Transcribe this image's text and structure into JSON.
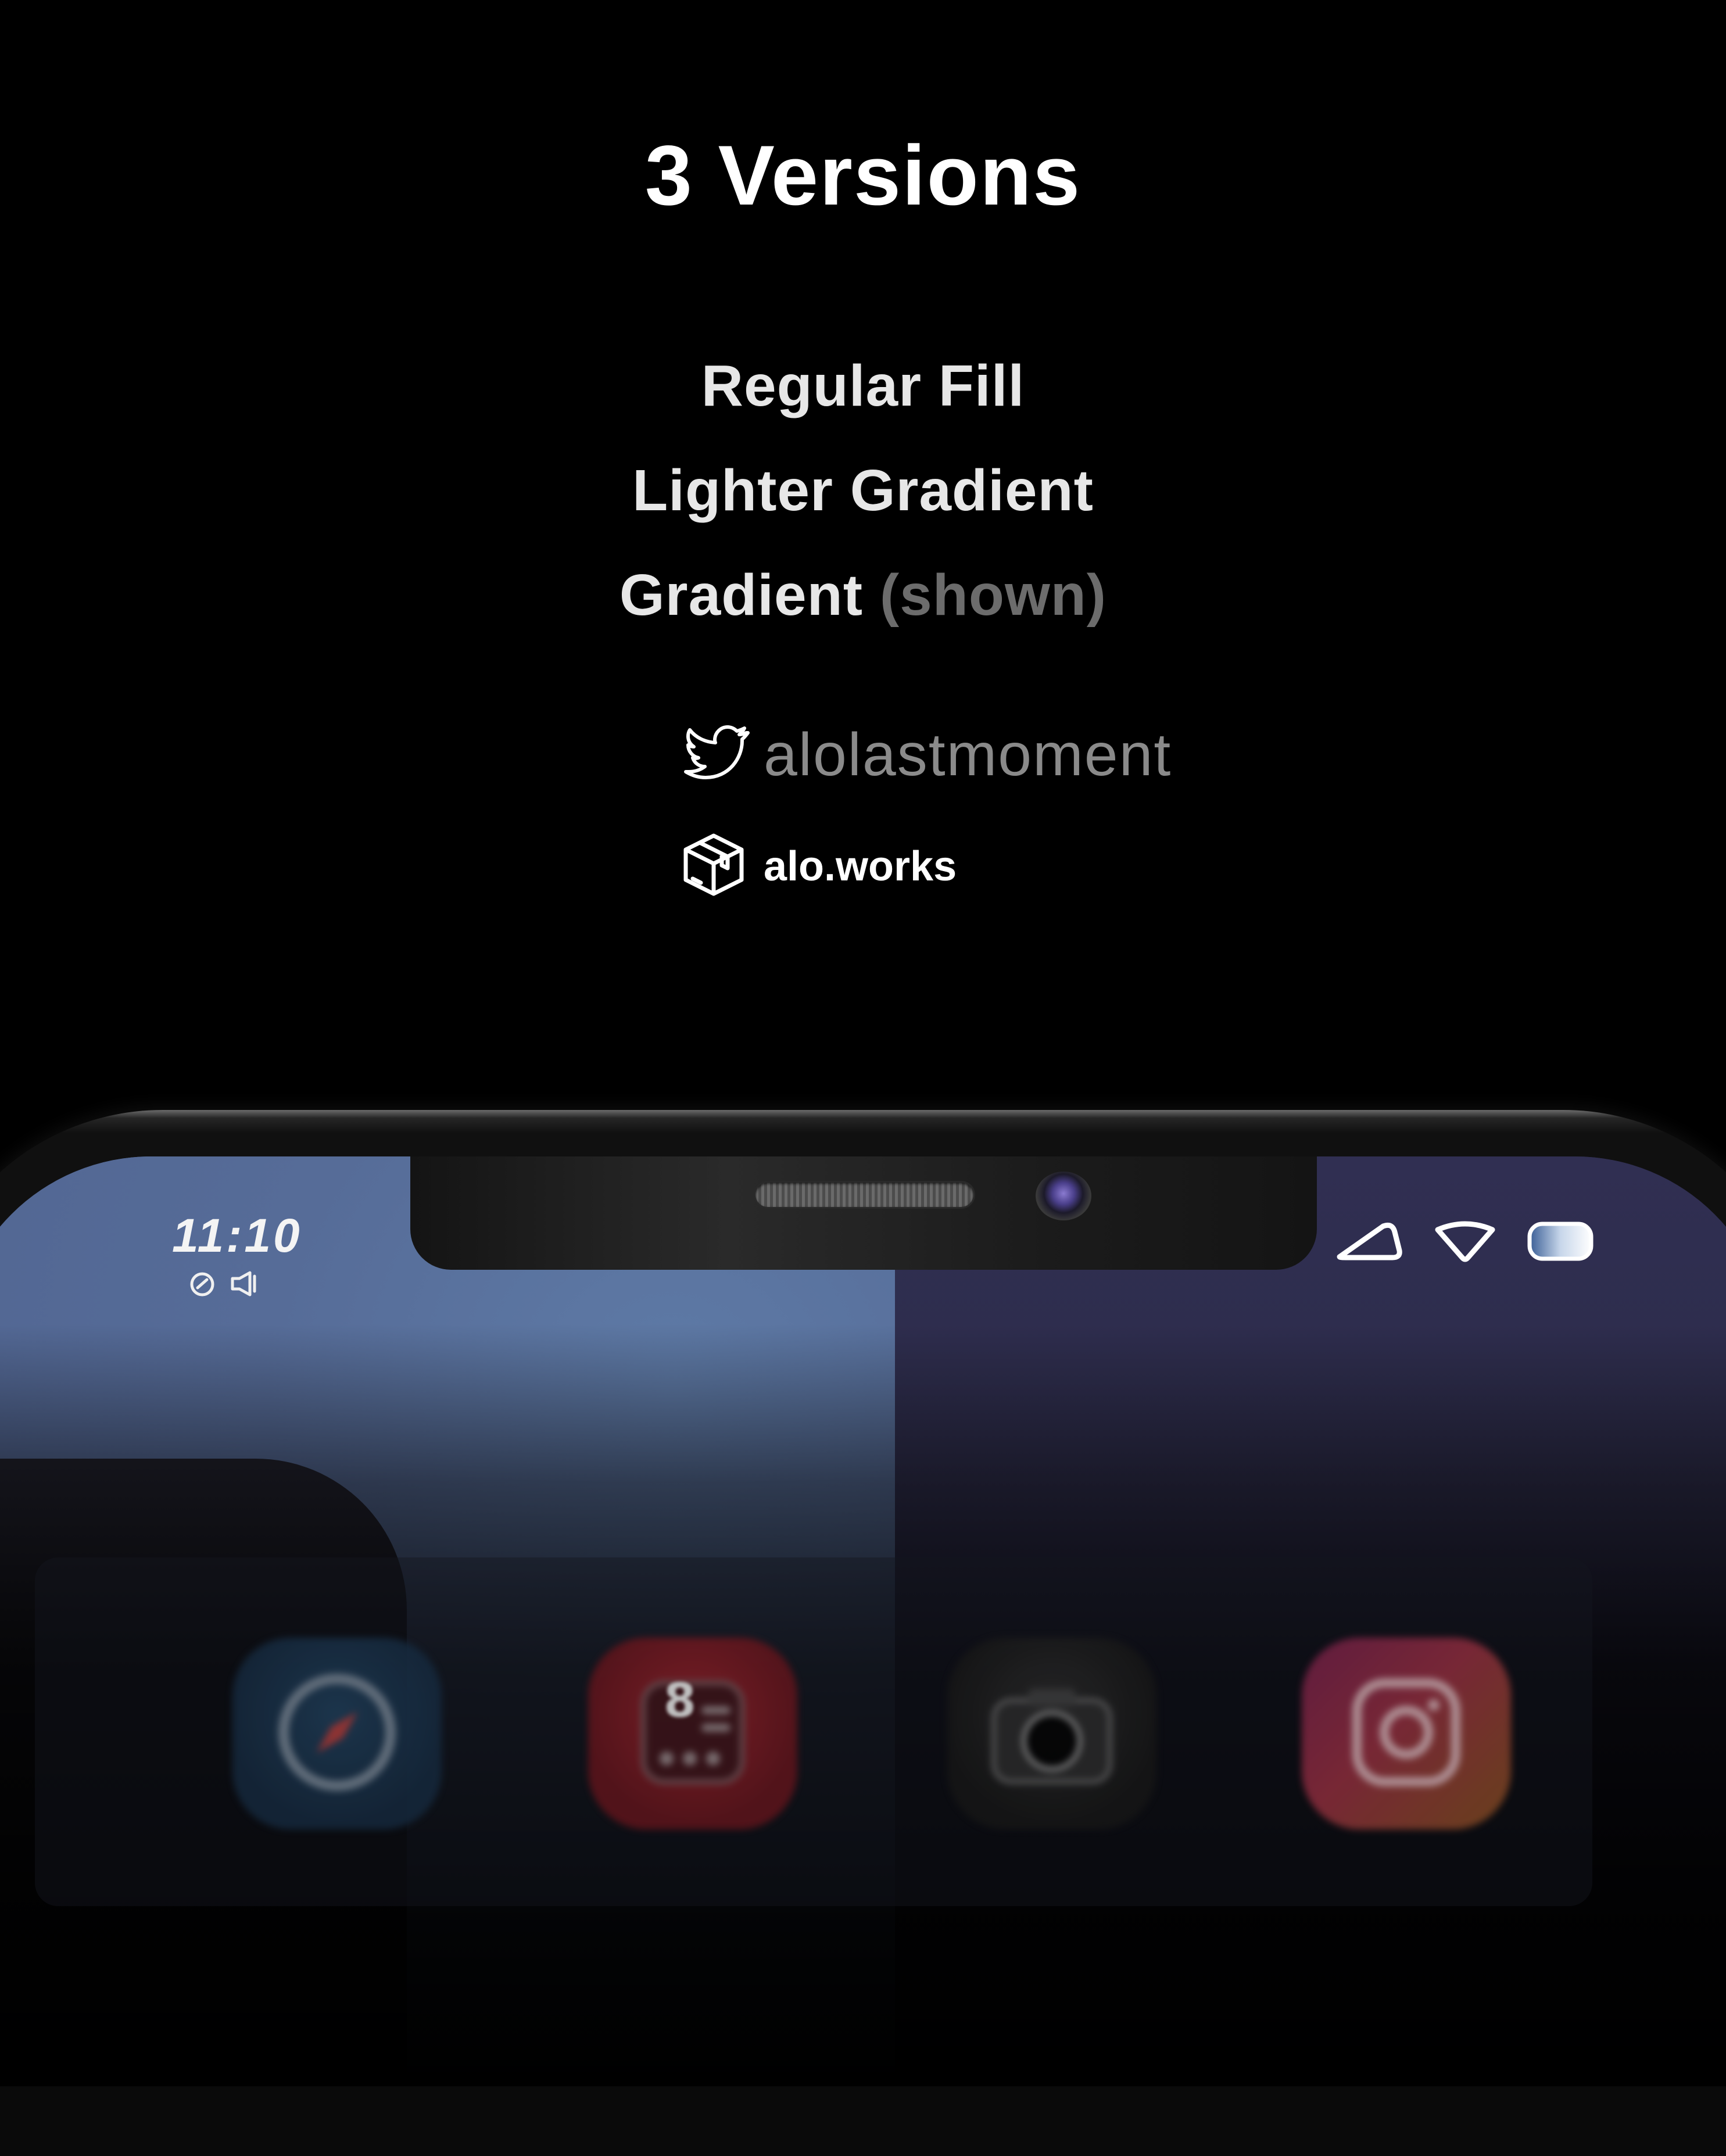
{
  "header": {
    "title": "3 Versions"
  },
  "versions": [
    {
      "label": "Regular Fill",
      "note": ""
    },
    {
      "label": "Lighter Gradient",
      "note": ""
    },
    {
      "label": "Gradient",
      "note": "(shown)"
    }
  ],
  "social": {
    "twitter_icon": "twitter-bird-icon",
    "twitter_handle": "alolastmoment",
    "site_icon": "package-box-icon",
    "site_label": "alo.works"
  },
  "phone": {
    "status_time": "11:10",
    "status_left_icons": [
      "alarm-icon",
      "speaker-icon"
    ],
    "status_right_icons": [
      "signal-triangle-icon",
      "wifi-icon",
      "battery-icon"
    ],
    "dock_apps": [
      {
        "name": "safari",
        "icon": "compass-icon"
      },
      {
        "name": "calendar",
        "icon": "calendar-icon",
        "label": "8"
      },
      {
        "name": "camera",
        "icon": "camera-icon"
      },
      {
        "name": "instagram",
        "icon": "instagram-icon"
      }
    ]
  },
  "colors": {
    "background": "#000000",
    "headline": "#ffffff",
    "version_text": "#e7e7e7",
    "muted": "#6c6c6c",
    "twitter_handle": "#8a8a8a",
    "wallpaper_blue": "#5a6f9d",
    "wallpaper_dark": "#2c2c4a"
  }
}
